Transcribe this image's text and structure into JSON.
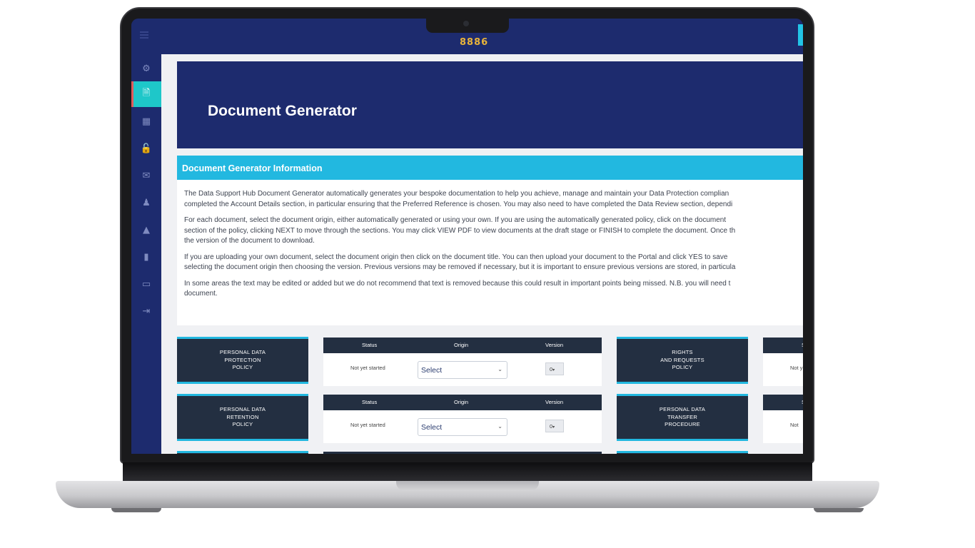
{
  "app": {
    "logo_text": "8886",
    "sidebar_icons": [
      "gear-icon",
      "document-icon",
      "calendar-icon",
      "unlock-icon",
      "inbox-icon",
      "user-graduate-icon",
      "graduation-cap-icon",
      "clipboard-icon",
      "credit-card-icon",
      "sign-out-icon"
    ],
    "active_sidebar_index": 1
  },
  "page": {
    "title": "Document Generator"
  },
  "info": {
    "heading": "Document Generator Information",
    "paragraphs": [
      "The Data Support Hub Document Generator automatically generates your bespoke documentation to help you achieve, manage and maintain your Data Protection complian",
      "completed the Account Details section, in particular ensuring that the Preferred Reference is chosen. You may also need to have completed the Data Review section, dependi",
      "For each document, select the document origin, either automatically generated or using your own. If you are using the automatically generated policy, click on the document",
      "section of the policy, clicking NEXT to move through the sections. You may click VIEW PDF to view documents at the draft stage or FINISH to complete the document. Once th",
      "the version of the document to download.",
      "If you are uploading your own document, select the document origin then click on the document title. You can then upload your document to the Portal and click YES to save",
      "selecting the document origin then choosing the version. Previous versions may be removed if necessary, but it is important to ensure previous versions are stored, in particula",
      "In some areas the text may be edited or added but we do not recommend that text is removed because this could result in important points being missed. N.B. you will need t",
      "document."
    ]
  },
  "documents": {
    "headers": {
      "status": "Status",
      "origin": "Origin",
      "version": "Version"
    },
    "items": [
      {
        "title": "PERSONAL DATA\nPROTECTION\nPOLICY",
        "status": "Not yet started",
        "origin": "Select",
        "version": "0"
      },
      {
        "title": "RIGHTS\nAND REQUESTS\nPOLICY",
        "status": "Not y",
        "origin": "",
        "version": ""
      },
      {
        "title": "PERSONAL DATA\nRETENTION\nPOLICY",
        "status": "Not yet started",
        "origin": "Select",
        "version": "0"
      },
      {
        "title": "PERSONAL DATA\nTRANSFER\nPROCEDURE",
        "status": "Not",
        "origin": "",
        "version": ""
      }
    ],
    "right_header_partial": "S"
  },
  "colors": {
    "navy": "#1d2b6e",
    "accent_cyan": "#22b8e0",
    "card_dark": "#232f41",
    "logo_gold": "#e9b43a"
  }
}
